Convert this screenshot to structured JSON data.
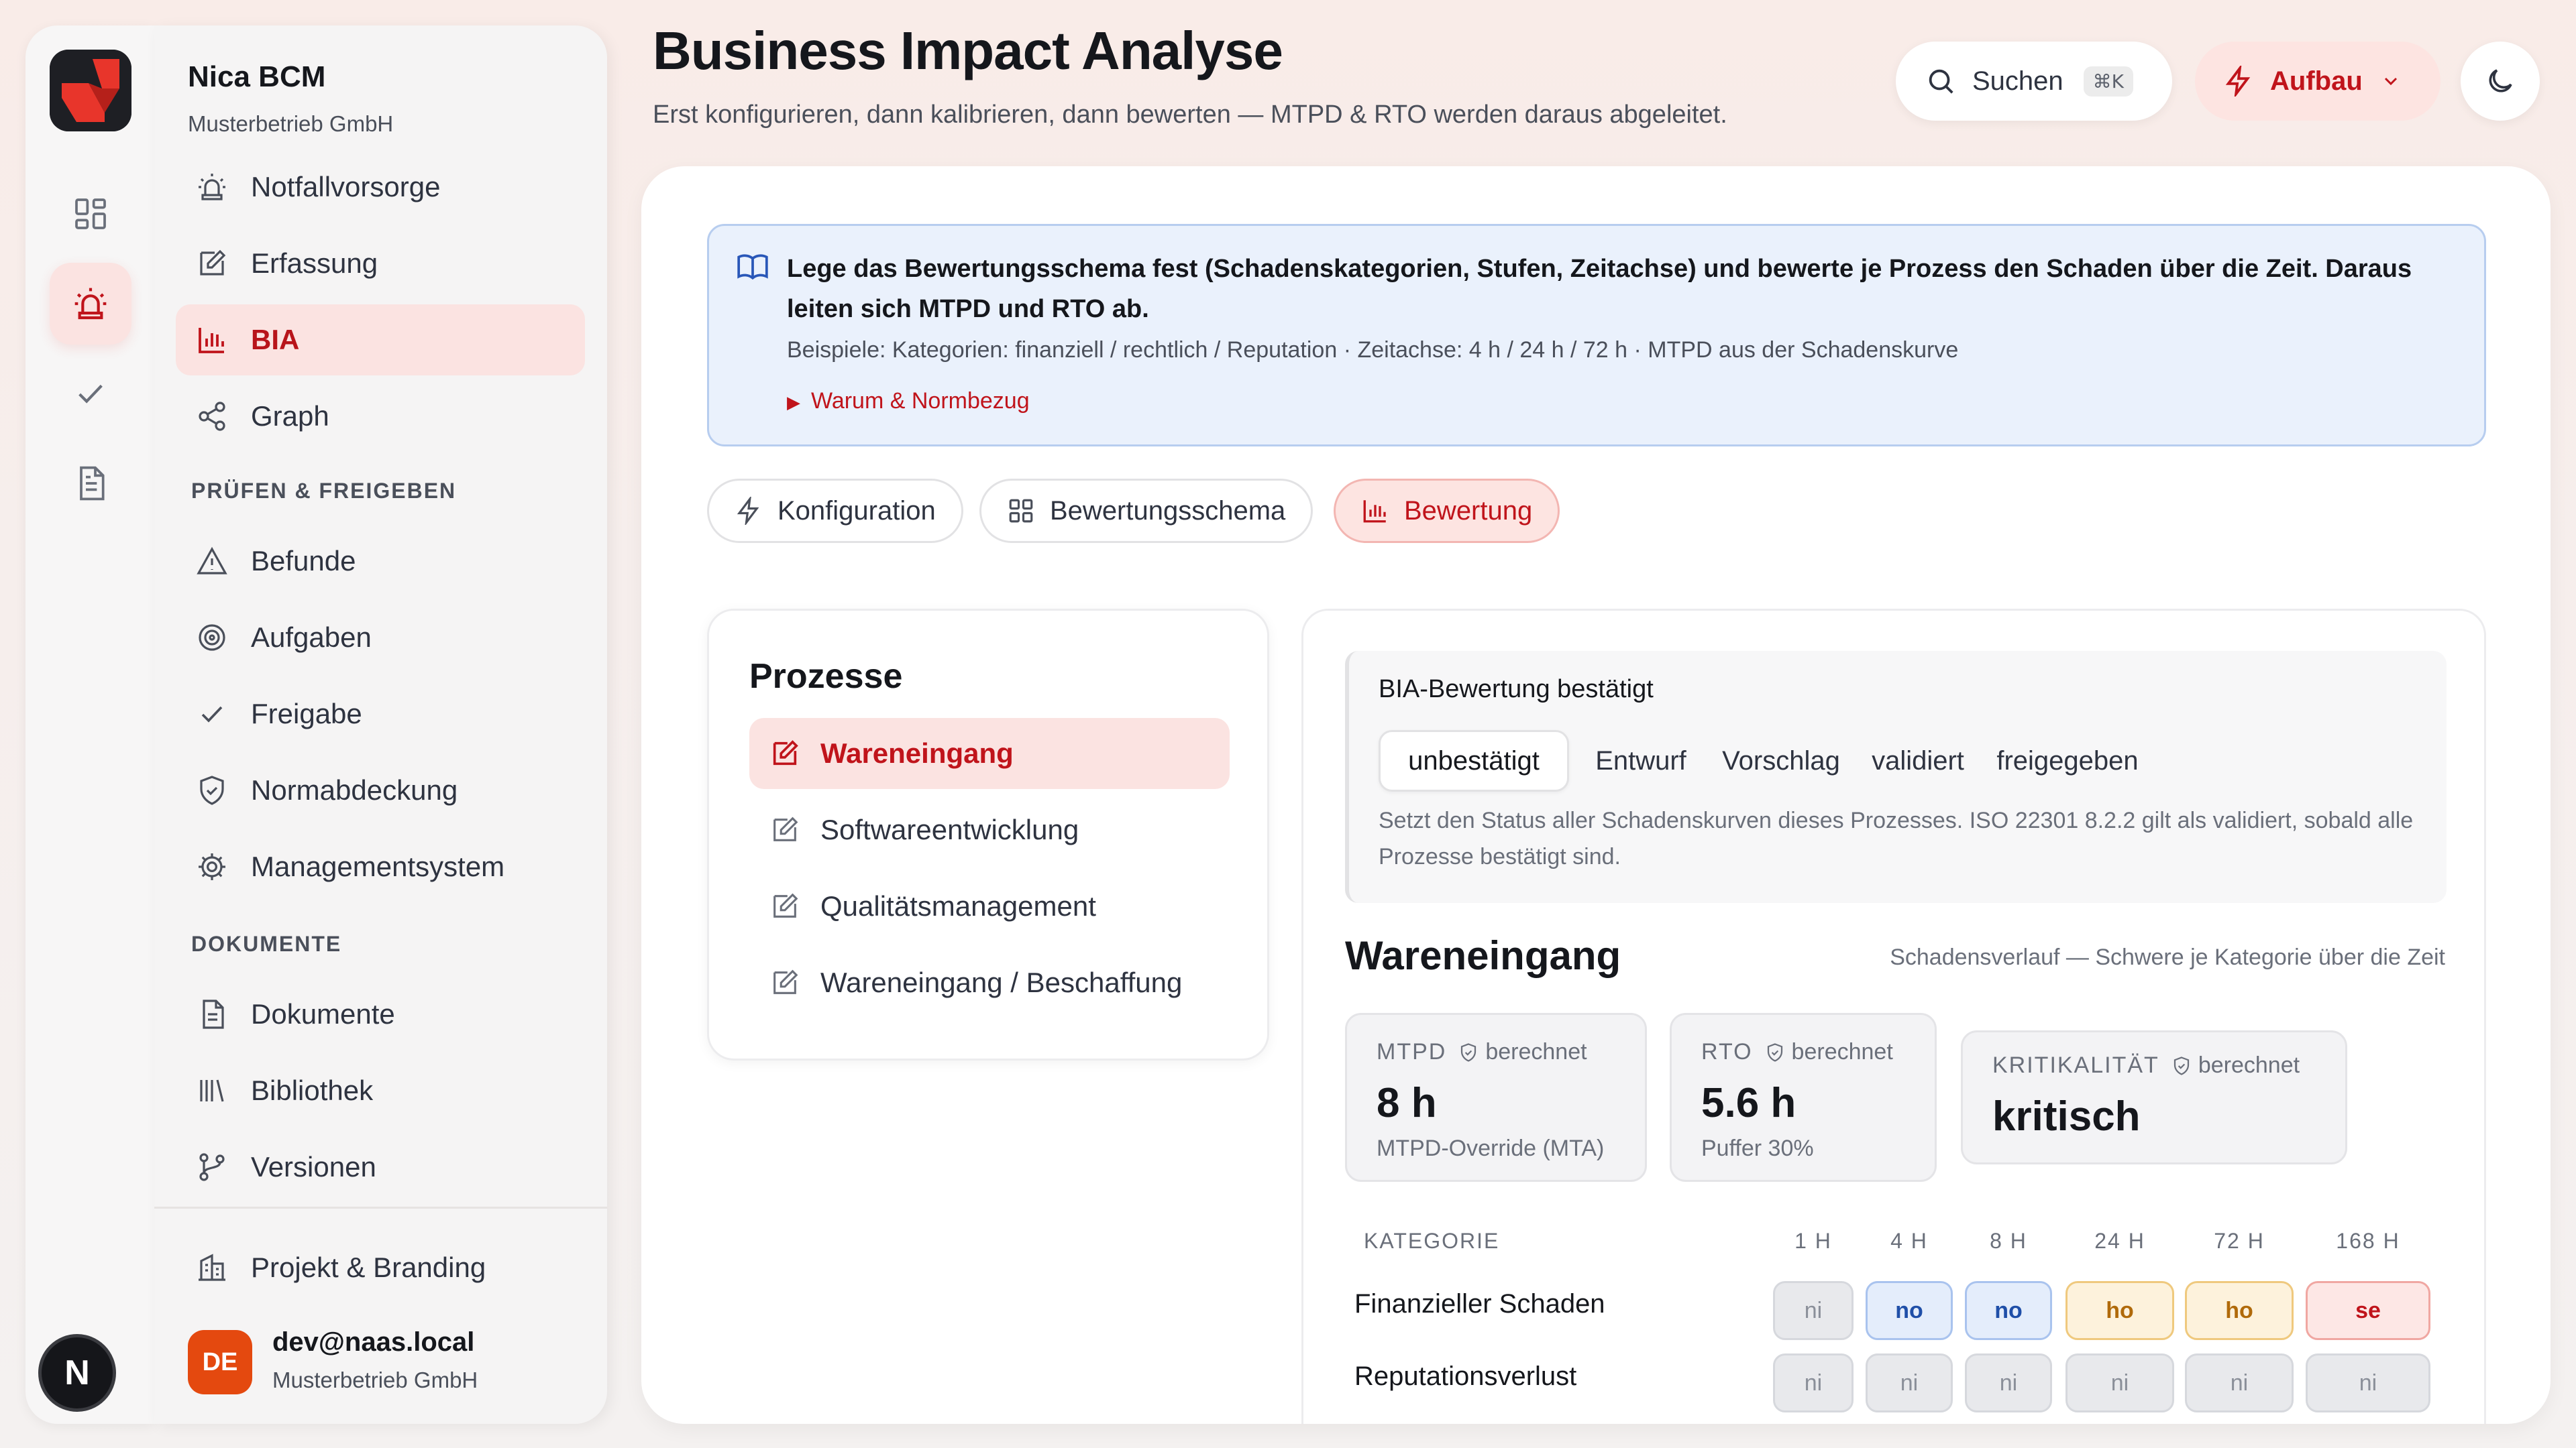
{
  "app": {
    "name": "Nica BCM",
    "org": "Musterbetrieb GmbH",
    "avatar_letter": "N"
  },
  "colors": {
    "accent": "#c0141b",
    "accent_soft": "#fde4e1",
    "info_bg": "#eaf1fc",
    "level_no": "#1f4fa8",
    "level_ho": "#b06a0a",
    "level_se": "#c0141b"
  },
  "rail": {
    "icons": [
      "dashboard-icon",
      "alarm-icon",
      "check-icon",
      "document-icon"
    ]
  },
  "sidebar": {
    "items_top": [
      {
        "label": "Notfallvorsorge",
        "icon": "alarm-icon"
      },
      {
        "label": "Erfassung",
        "icon": "edit-icon"
      },
      {
        "label": "BIA",
        "icon": "bar-chart-icon"
      },
      {
        "label": "Graph",
        "icon": "share-icon"
      }
    ],
    "section_review": "PRÜFEN & FREIGEBEN",
    "items_review": [
      {
        "label": "Befunde",
        "icon": "warning-icon"
      },
      {
        "label": "Aufgaben",
        "icon": "target-icon"
      },
      {
        "label": "Freigabe",
        "icon": "check-icon"
      },
      {
        "label": "Normabdeckung",
        "icon": "shield-icon"
      },
      {
        "label": "Managementsystem",
        "icon": "gear-icon"
      }
    ],
    "section_docs": "DOKUMENTE",
    "items_docs": [
      {
        "label": "Dokumente",
        "icon": "document-icon"
      },
      {
        "label": "Bibliothek",
        "icon": "library-icon"
      },
      {
        "label": "Versionen",
        "icon": "branch-icon"
      }
    ],
    "project": "Projekt & Branding",
    "user": {
      "initials": "DE",
      "email": "dev@naas.local",
      "org": "Musterbetrieb GmbH"
    }
  },
  "header": {
    "title": "Business Impact Analyse",
    "subtitle": "Erst konfigurieren, dann kalibrieren, dann bewerten — MTPD & RTO werden daraus abgeleitet.",
    "search_label": "Suchen",
    "search_shortcut": "⌘K",
    "mode_label": "Aufbau"
  },
  "info": {
    "main": "Lege das Bewertungsschema fest (Schadenskategorien, Stufen, Zeitachse) und bewerte je Prozess den Schaden über die Zeit. Daraus leiten sich MTPD und RTO ab.",
    "examples": "Beispiele: Kategorien: finanziell / rechtlich / Reputation · Zeitachse: 4 h / 24 h / 72 h · MTPD aus der Schadenskurve",
    "link": "Warum & Normbezug"
  },
  "tabs": [
    {
      "label": "Konfiguration"
    },
    {
      "label": "Bewertungsschema"
    },
    {
      "label": "Bewertung"
    }
  ],
  "processes": {
    "title": "Prozesse",
    "items": [
      "Wareneingang",
      "Softwareentwicklung",
      "Qualitätsmanagement",
      "Wareneingang / Beschaffung"
    ]
  },
  "status": {
    "title": "BIA-Bewertung bestätigt",
    "options": [
      "unbestätigt",
      "Entwurf",
      "Vorschlag",
      "validiert",
      "freigegeben"
    ],
    "note": "Setzt den Status aller Schadenskurven dieses Prozesses. ISO 22301 8.2.2 gilt als validiert, sobald alle Prozesse bestätigt sind."
  },
  "detail": {
    "title": "Wareneingang",
    "hint": "Schadensverlauf — Schwere je Kategorie über die Zeit",
    "computed_label": "berechnet",
    "metrics": [
      {
        "label": "MTPD",
        "value": "8 h",
        "sub": "MTPD-Override (MTA)"
      },
      {
        "label": "RTO",
        "value": "5.6 h",
        "sub": "Puffer 30%"
      },
      {
        "label": "KRITIKALITÄT",
        "value": "kritisch",
        "sub": ""
      }
    ],
    "grid": {
      "category_header": "KATEGORIE",
      "columns": [
        "1 H",
        "4 H",
        "8 H",
        "24 H",
        "72 H",
        "168 H"
      ],
      "rows": [
        {
          "label": "Finanzieller Schaden",
          "cells": [
            "ni",
            "no",
            "no",
            "ho",
            "ho",
            "se"
          ]
        },
        {
          "label": "Reputationsverlust",
          "cells": [
            "ni",
            "ni",
            "ni",
            "ni",
            "ni",
            "ni"
          ]
        }
      ]
    }
  }
}
